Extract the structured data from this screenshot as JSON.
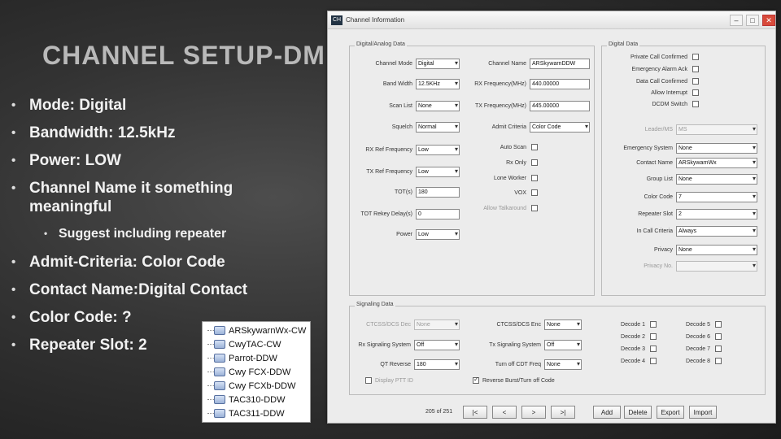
{
  "slide": {
    "title": "CHANNEL SETUP-DMR",
    "bullets": [
      "Mode: Digital",
      "Bandwidth: 12.5kHz",
      "Power:  LOW",
      "Channel  Name it something meaningful",
      "Suggest including repeater",
      "Admit-Criteria:   Color   Code",
      "Contact   Name:Digital   Contact",
      "Color  Code: ?",
      "Repeater  Slot: 2"
    ]
  },
  "channel_list": [
    "ARSkywarnWx-CW",
    "CwyTAC-CW",
    "Parrot-DDW",
    "Cwy FCX-DDW",
    "Cwy FCXb-DDW",
    "TAC310-DDW",
    "TAC311-DDW"
  ],
  "dialog": {
    "title": "Channel Information",
    "app_icon": "CH",
    "window_buttons": [
      "–",
      "□",
      "✕"
    ],
    "digital_analog_group": "Digital/Analog Data",
    "digital_group": "Digital Data",
    "signaling_group": "Signaling Data",
    "left_fields": [
      {
        "label": "Channel Mode",
        "value": "Digital"
      },
      {
        "label": "Band Width",
        "value": "12.5KHz"
      },
      {
        "label": "Scan List",
        "value": "None"
      },
      {
        "label": "Squelch",
        "value": "Normal"
      },
      {
        "label": "RX Ref Frequency",
        "value": "Low"
      },
      {
        "label": "TX Ref Frequency",
        "value": "Low"
      },
      {
        "label": "TOT(s)",
        "value": "180"
      },
      {
        "label": "TOT Rekey Delay(s)",
        "value": "0"
      },
      {
        "label": "Power",
        "value": "Low"
      }
    ],
    "mid_fields": [
      {
        "label": "Channel Name",
        "value": "ARSkywarnDDW"
      },
      {
        "label": "RX Frequency(MHz)",
        "value": "440.00000"
      },
      {
        "label": "TX Frequency(MHz)",
        "value": "445.00000"
      },
      {
        "label": "Admit Criteria",
        "value": "Color Code"
      }
    ],
    "mid_checks": [
      "Auto Scan",
      "Rx Only",
      "Lone Worker",
      "VOX",
      "Allow Talkaround"
    ],
    "digital_checks": [
      "Private Call Confirmed",
      "Emergency Alarm Ack",
      "Data Call Confirmed",
      "Allow Interrupt",
      "DCDM Switch"
    ],
    "digital_fields": [
      {
        "label": "Leader/MS",
        "value": "MS",
        "disabled": true
      },
      {
        "label": "Emergency System",
        "value": "None"
      },
      {
        "label": "Contact Name",
        "value": "ARSkywarnWx"
      },
      {
        "label": "Group List",
        "value": "None"
      },
      {
        "label": "Color Code",
        "value": "7"
      },
      {
        "label": "Repeater Slot",
        "value": "2"
      },
      {
        "label": "In Call Criteria",
        "value": "Always"
      },
      {
        "label": "Privacy",
        "value": "None"
      },
      {
        "label": "Privacy No.",
        "value": "",
        "disabled": true
      }
    ],
    "sig_left": [
      {
        "label": "CTCSS/DCS Dec",
        "value": "None",
        "disabled": true
      },
      {
        "label": "Rx Signaling System",
        "value": "Off"
      },
      {
        "label": "QT Reverse",
        "value": "180"
      }
    ],
    "sig_mid": [
      {
        "label": "CTCSS/DCS Enc",
        "value": "None"
      },
      {
        "label": "Tx Signaling System",
        "value": "Off"
      },
      {
        "label": "Turn off CDT Freq",
        "value": "None"
      }
    ],
    "decodes": [
      "Decode 1",
      "Decode 2",
      "Decode 3",
      "Decode 4",
      "Decode 5",
      "Decode 6",
      "Decode 7",
      "Decode 8"
    ],
    "display_ptt": "Display PTT ID",
    "reverse_burst": "Reverse Burst/Turn off Code",
    "counter": "205 of 251",
    "nav_buttons": [
      "|<",
      "<",
      ">",
      ">|"
    ],
    "action_buttons": [
      "Add",
      "Delete",
      "Export",
      "Import"
    ]
  }
}
